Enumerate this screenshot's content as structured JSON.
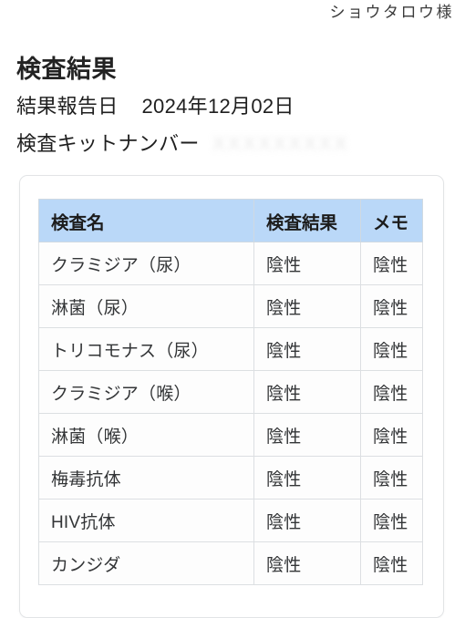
{
  "header": {
    "user_name": "ショウタロウ様"
  },
  "page_title": "検査結果",
  "info": {
    "report_date_label": "結果報告日",
    "report_date_value": "2024年12月02日",
    "kit_number_label": "検査キットナンバー",
    "kit_number_value": "XXXXXXXXX"
  },
  "table": {
    "columns": [
      "検査名",
      "検査結果",
      "メモ"
    ],
    "rows": [
      {
        "name": "クラミジア（尿）",
        "result": "陰性",
        "memo": "陰性"
      },
      {
        "name": "淋菌（尿）",
        "result": "陰性",
        "memo": "陰性"
      },
      {
        "name": "トリコモナス（尿）",
        "result": "陰性",
        "memo": "陰性"
      },
      {
        "name": "クラミジア（喉）",
        "result": "陰性",
        "memo": "陰性"
      },
      {
        "name": "淋菌（喉）",
        "result": "陰性",
        "memo": "陰性"
      },
      {
        "name": "梅毒抗体",
        "result": "陰性",
        "memo": "陰性"
      },
      {
        "name": "HIV抗体",
        "result": "陰性",
        "memo": "陰性"
      },
      {
        "name": "カンジダ",
        "result": "陰性",
        "memo": "陰性"
      }
    ]
  },
  "colors": {
    "table_header_bg": "#bad8f8",
    "page_bg": "#ffffff",
    "text": "#333537",
    "border": "#dcdfe2"
  }
}
